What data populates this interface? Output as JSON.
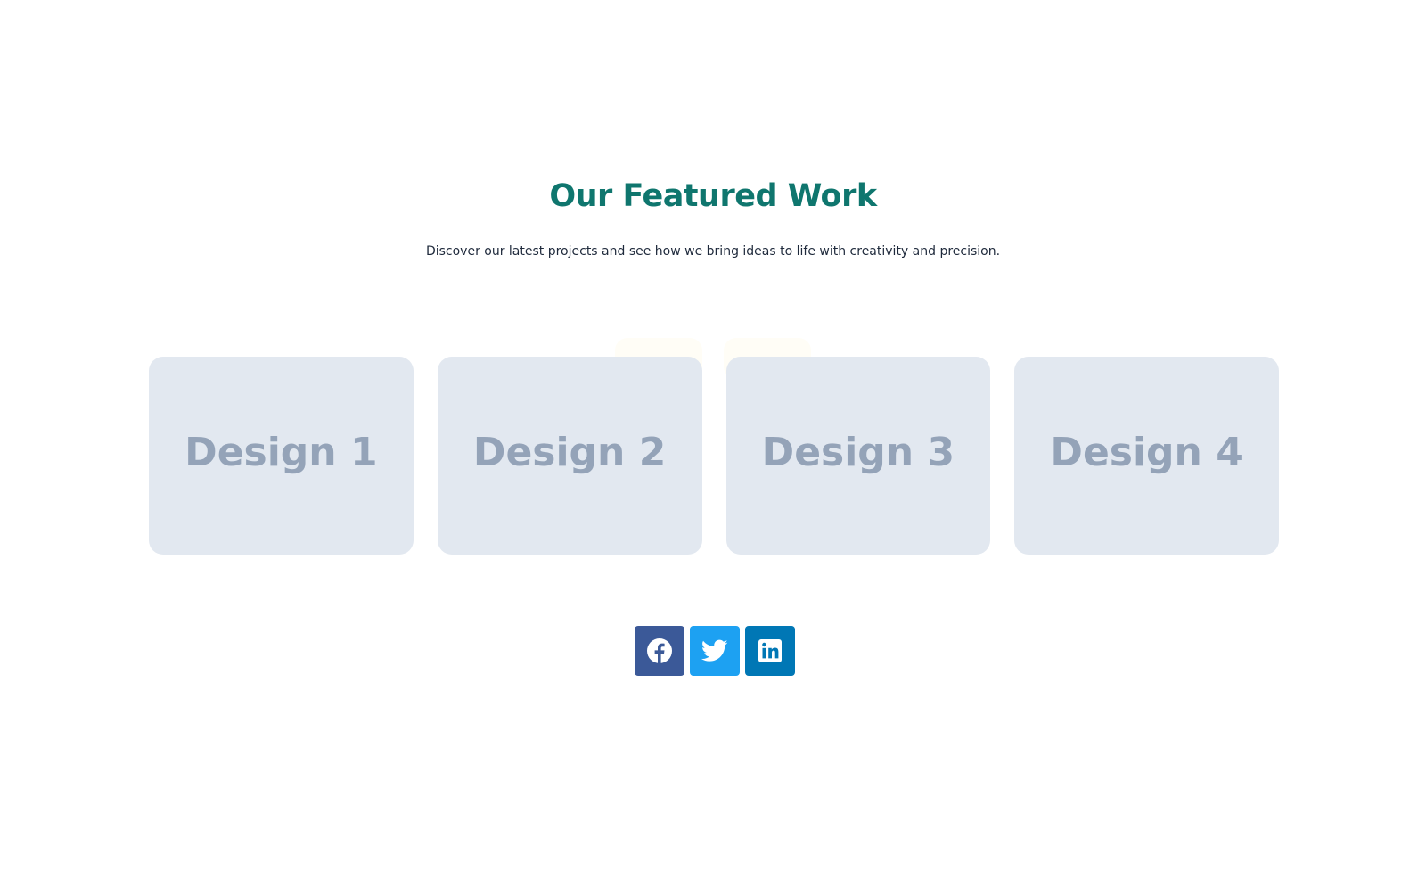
{
  "section": {
    "title": "Our Featured Work",
    "subtitle": "Discover our latest projects and see how we bring ideas to life with creativity and precision."
  },
  "portfolio": {
    "items": [
      {
        "label": "Design 1"
      },
      {
        "label": "Design 2"
      },
      {
        "label": "Design 3"
      },
      {
        "label": "Design 4"
      }
    ]
  },
  "social": {
    "links": [
      {
        "icon": "facebook-icon",
        "color": "#3b5998"
      },
      {
        "icon": "twitter-icon",
        "color": "#1da1f2"
      },
      {
        "icon": "linkedin-icon",
        "color": "#0077b5"
      }
    ]
  },
  "colors": {
    "accent": "#0f766e",
    "card_bg": "#e2e8f0",
    "card_text": "#94a3b8",
    "body_text": "#1e293b"
  }
}
